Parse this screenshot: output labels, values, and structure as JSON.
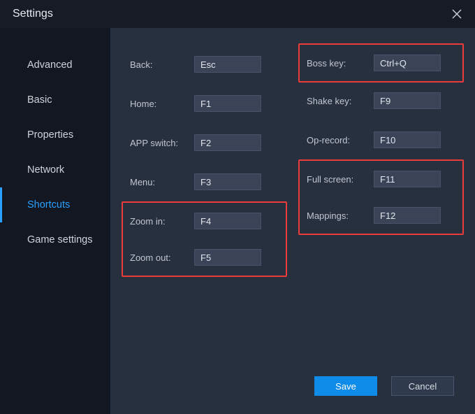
{
  "title": "Settings",
  "sidebar": {
    "items": [
      {
        "label": "Advanced"
      },
      {
        "label": "Basic"
      },
      {
        "label": "Properties"
      },
      {
        "label": "Network"
      },
      {
        "label": "Shortcuts"
      },
      {
        "label": "Game settings"
      }
    ],
    "active_index": 4
  },
  "shortcuts": {
    "left": [
      {
        "label": "Back:",
        "value": "Esc",
        "hl": false
      },
      {
        "label": "Home:",
        "value": "F1",
        "hl": false
      },
      {
        "label": "APP switch:",
        "value": "F2",
        "hl": false
      },
      {
        "label": "Menu:",
        "value": "F3",
        "hl": false
      },
      {
        "label": "Zoom in:",
        "value": "F4",
        "hl": true
      },
      {
        "label": "Zoom out:",
        "value": "F5",
        "hl": true
      }
    ],
    "right": [
      {
        "label": "Boss key:",
        "value": "Ctrl+Q",
        "hl": true
      },
      {
        "label": "Shake key:",
        "value": "F9",
        "hl": false
      },
      {
        "label": "Op-record:",
        "value": "F10",
        "hl": false
      },
      {
        "label": "Full screen:",
        "value": "F11",
        "hl": true
      },
      {
        "label": "Mappings:",
        "value": "F12",
        "hl": true
      }
    ]
  },
  "footer": {
    "save": "Save",
    "cancel": "Cancel"
  }
}
